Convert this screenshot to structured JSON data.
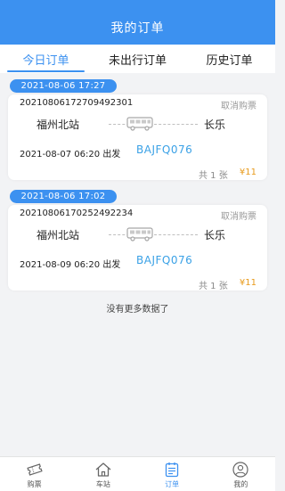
{
  "header": {
    "title": "我的订单"
  },
  "tabs": [
    {
      "label": "今日订单",
      "active": true
    },
    {
      "label": "未出行订单",
      "active": false
    },
    {
      "label": "历史订单",
      "active": false
    }
  ],
  "orders": [
    {
      "created": "2021-08-06 17:27",
      "order_no": "20210806172709492301",
      "cancel_label": "取消购票",
      "from": "福州北站",
      "to": "长乐",
      "depart": "2021-08-07 06:20 出发",
      "trip": "BAJFQ076",
      "count": "共 1 张",
      "price": "¥11"
    },
    {
      "created": "2021-08-06 17:02",
      "order_no": "20210806170252492234",
      "cancel_label": "取消购票",
      "from": "福州北站",
      "to": "长乐",
      "depart": "2021-08-09 06:20 出发",
      "trip": "BAJFQ076",
      "count": "共 1 张",
      "price": "¥11"
    }
  ],
  "no_more_text": "没有更多数据了",
  "bottom_nav": [
    {
      "label": "购票",
      "icon": "ticket-icon",
      "active": false
    },
    {
      "label": "车站",
      "icon": "home-icon",
      "active": false
    },
    {
      "label": "订单",
      "icon": "order-list-icon",
      "active": true
    },
    {
      "label": "我的",
      "icon": "user-icon",
      "active": false
    }
  ],
  "colors": {
    "primary": "#3c91f0",
    "trip_code": "#3aa1e6",
    "price": "#e89a1a",
    "background": "#f2f3f5"
  }
}
